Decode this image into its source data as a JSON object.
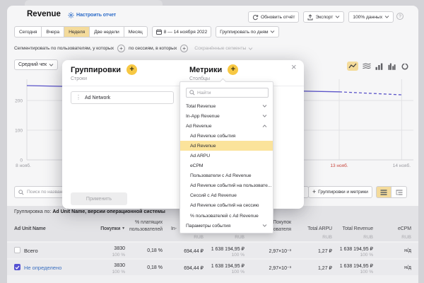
{
  "colors": {
    "accent": "#f7c843",
    "selected_bg": "#f4db9b",
    "highlight_row": "#fbe39b",
    "link": "#2e6dc9",
    "red": "#c8473e",
    "line": "#5b54c9",
    "checkbox_checked": "#5551d2"
  },
  "header": {
    "title": "Revenue",
    "configure_link": "Настроить отчет",
    "refresh_button": "Обновить отчёт",
    "export_button": "Экспорт",
    "sampling_button": "100% данных"
  },
  "filters": {
    "period_tabs": [
      "Сегодня",
      "Вчера",
      "Неделя",
      "Две недели",
      "Месяц"
    ],
    "selected_tab": "Неделя",
    "date_range": "8 — 14 ноября 2022",
    "group_by": "Группировать по дням"
  },
  "segments": {
    "by_users_label": "Сегментировать по пользователям, у которых",
    "by_sessions_label": "по сессиям, в которых",
    "saved_label": "Сохранённые сегменты"
  },
  "chart_controls": {
    "metric_selector": "Средний чек",
    "chart_types": [
      "line",
      "stacked",
      "bars",
      "grouped-bars",
      "pie"
    ],
    "selected_type": "line"
  },
  "chart_data": {
    "type": "line",
    "title": "Средний чек",
    "y_ticks": [
      200,
      100,
      0
    ],
    "x_labels": [
      {
        "text": "8 нояб.",
        "d": 0
      },
      {
        "text": "13 нояб.",
        "d": 5,
        "highlight": true
      },
      {
        "text": "14 нояб.",
        "d": 6
      }
    ],
    "series": [
      {
        "name": "Средний чек",
        "solid": [
          {
            "d": 0,
            "v": 250
          },
          {
            "d": 5,
            "v": 229
          }
        ],
        "forecast": [
          {
            "d": 5,
            "v": 229
          },
          {
            "d": 6,
            "v": 219
          }
        ]
      }
    ],
    "ylim": [
      0,
      280
    ],
    "grid": true
  },
  "modal": {
    "groupings": {
      "title": "Группировки",
      "subtitle": "Строки",
      "rows": [
        {
          "label": "Ad Network"
        }
      ],
      "apply_button": "Применить"
    },
    "metrics": {
      "title": "Метрики",
      "subtitle": "Столбцы",
      "search_placeholder": "Найти",
      "items": [
        {
          "label": "Total Revenue",
          "level": 0,
          "expanded": false
        },
        {
          "label": "In-App Revenue",
          "level": 0,
          "expanded": false
        },
        {
          "label": "Ad Revenue",
          "level": 0,
          "expanded": true
        },
        {
          "label": "Ad Revenue события",
          "level": 1
        },
        {
          "label": "Ad Revenue",
          "level": 1,
          "selected": true
        },
        {
          "label": "Ad ARPU",
          "level": 1
        },
        {
          "label": "eCPM",
          "level": 1
        },
        {
          "label": "Пользователи с Ad Revenue",
          "level": 1
        },
        {
          "label": "Ad Revenue событий на пользовате...",
          "level": 1
        },
        {
          "label": "Сессий с Ad Revenue",
          "level": 1
        },
        {
          "label": "Ad Revenue событий на сессию",
          "level": 1
        },
        {
          "label": "% пользователей с Ad Revenue",
          "level": 1
        },
        {
          "label": "Параметры события",
          "level": 0,
          "expanded": false
        }
      ]
    }
  },
  "toolbar": {
    "search_placeholder": "Поиск по названию",
    "add_button": "Группировки и метрики"
  },
  "grouping_summary": {
    "prefix": "Группировка по:",
    "value": "Ad Unit Name, версии операционной системы"
  },
  "table": {
    "columns": [
      {
        "label": "Ad Unit Name"
      },
      {
        "label": "Покупки",
        "sorted": "desc"
      },
      {
        "label": "% платящих пользователей",
        "lines": [
          "% платящих",
          "пользователей"
        ]
      },
      {
        "label_partial": "In-",
        "unit": "RUB"
      },
      {
        "label_partial": "",
        "unit": "RUB"
      },
      {
        "label": "Покупок на пользователя",
        "lines": [
          "Покупок",
          "на пользователя"
        ]
      },
      {
        "label": "Total ARPU",
        "unit": "RUB"
      },
      {
        "label": "Total Revenue",
        "unit": "RUB"
      },
      {
        "label": "eCPM",
        "unit": "RUB"
      }
    ],
    "rows": [
      {
        "name": "Всего",
        "checked": false,
        "values": [
          {
            "v": "3830",
            "sub": "100 %"
          },
          {
            "v": "0,18 %"
          },
          {
            "v": "694,44 ₽"
          },
          {
            "v": "1 638 194,95 ₽",
            "sub": "100 %"
          },
          {
            "v": "2,97×10⁻³"
          },
          {
            "v": "1,27 ₽"
          },
          {
            "v": "1 638 194,95 ₽",
            "sub": "100 %"
          },
          {
            "v": "н/д"
          }
        ]
      },
      {
        "name": "Не определено",
        "checked": true,
        "values": [
          {
            "v": "3830",
            "sub": "100 %"
          },
          {
            "v": "0,18 %"
          },
          {
            "v": "694,44 ₽"
          },
          {
            "v": "1 638 194,95 ₽",
            "sub": "100 %"
          },
          {
            "v": "2,97×10⁻³"
          },
          {
            "v": "1,27 ₽"
          },
          {
            "v": "1 638 194,95 ₽",
            "sub": "100 %"
          },
          {
            "v": "н/д"
          }
        ]
      }
    ]
  }
}
